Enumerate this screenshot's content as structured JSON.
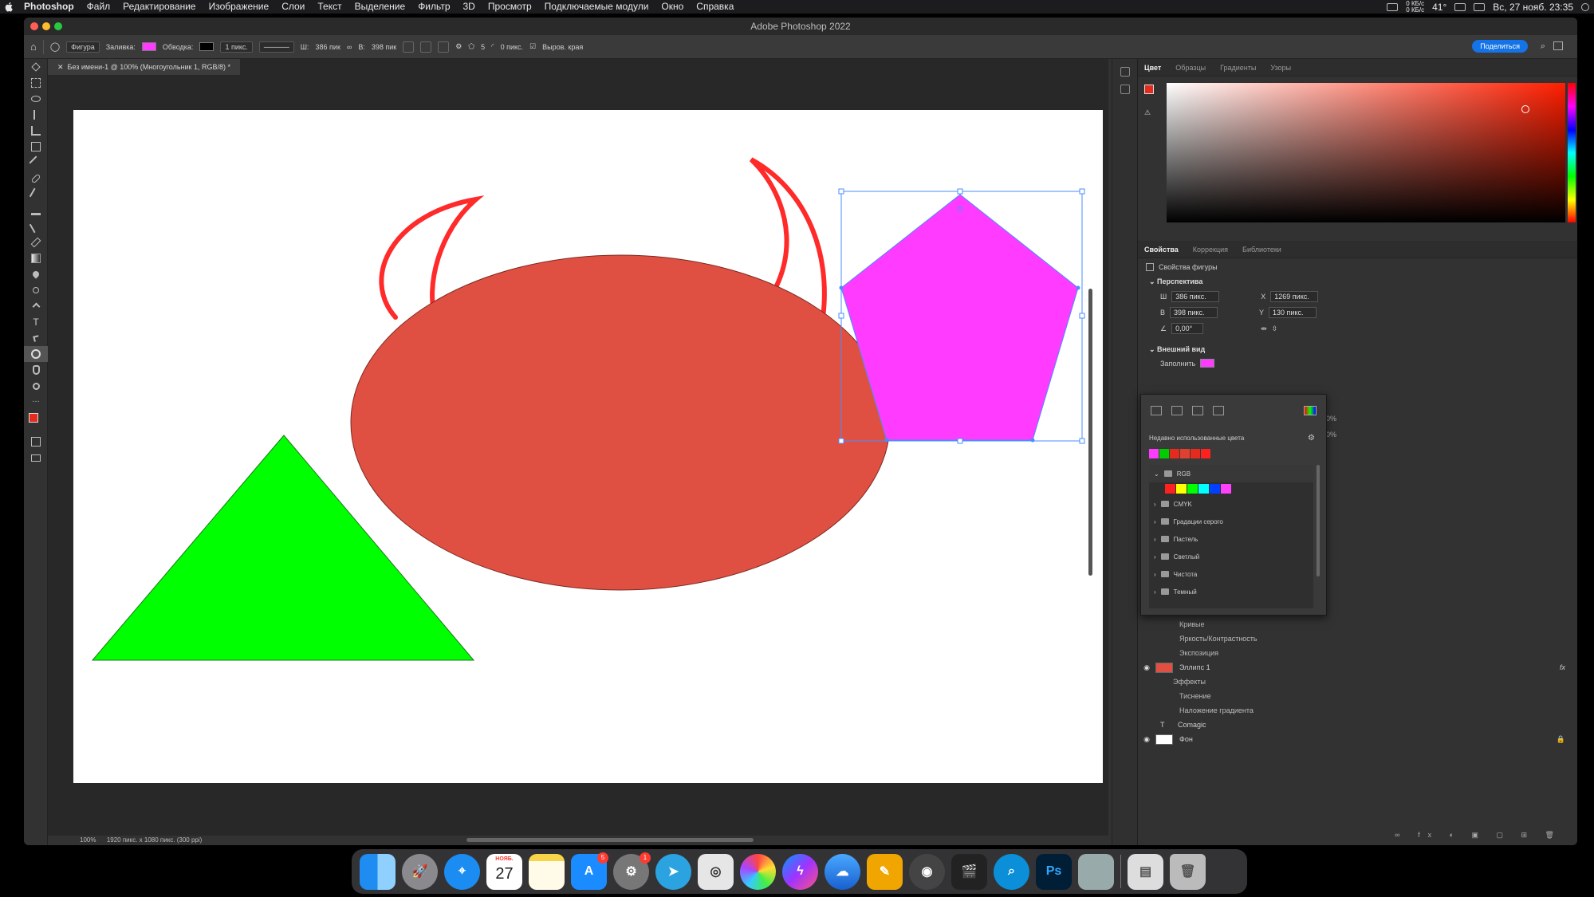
{
  "menubar": {
    "app_name": "Photoshop",
    "items": [
      "Файл",
      "Редактирование",
      "Изображение",
      "Слои",
      "Текст",
      "Выделение",
      "Фильтр",
      "3D",
      "Просмотр",
      "Подключаемые модули",
      "Окно",
      "Справка"
    ],
    "network_up": "0 КБ/с",
    "network_down": "0 КБ/с",
    "temperature": "41°",
    "datetime": "Вс, 27 нояб. 23:35"
  },
  "window": {
    "title": "Adobe Photoshop 2022"
  },
  "options_bar": {
    "mode": "Фигура",
    "fill_label": "Заливка:",
    "fill_color": "#ff3bff",
    "stroke_label": "Обводка:",
    "stroke_width": "1 пикс.",
    "w_label": "Ш:",
    "w_value": "386 пик",
    "h_label": "В:",
    "h_value": "398 пик",
    "sides": "5",
    "corner": "0 пикс.",
    "align_edges": "Выров. края",
    "share_label": "Поделиться"
  },
  "document": {
    "tab_title": "Без имени-1 @ 100% (Многоугольник 1, RGB/8) *",
    "status": "1920 пикс. x 1080 пикс. (300 ppi)",
    "zoom": "100%"
  },
  "canvas_shapes": {
    "triangle_color": "#00ff00",
    "ellipse_color": "#e05042",
    "pentagon_color": "#ff3bff",
    "horns_color": "#ff2a2a",
    "selection_color": "#4a8cff"
  },
  "color_panel": {
    "tabs": [
      "Цвет",
      "Образцы",
      "Градиенты",
      "Узоры"
    ],
    "fg_color": "#e52b1e",
    "bg_color": "#ffffff"
  },
  "properties_panel": {
    "tabs": [
      "Свойства",
      "Коррекция",
      "Библиотеки"
    ],
    "shape_props_label": "Свойства фигуры",
    "transform_title": "Перспектива",
    "w_label": "Ш",
    "w_value": "386 пикс.",
    "x_label": "X",
    "x_value": "1269 пикс.",
    "h_label": "В",
    "h_value": "398 пикс.",
    "y_label": "Y",
    "y_value": "130 пикс.",
    "angle_value": "0,00°",
    "appearance_title": "Внешний вид",
    "fill_label": "Заполнить"
  },
  "swatch_popup": {
    "recent_label": "Недавно использованные цвета",
    "recent_colors": [
      "#ff3bff",
      "#00cc00",
      "#e52b1e",
      "#e04030",
      "#e52b1e",
      "#ff2020"
    ],
    "folders": [
      {
        "name": "RGB",
        "open": true
      },
      {
        "name": "CMYK",
        "open": false
      },
      {
        "name": "Градации серого",
        "open": false
      },
      {
        "name": "Пастель",
        "open": false
      },
      {
        "name": "Светлый",
        "open": false
      },
      {
        "name": "Чистота",
        "open": false
      },
      {
        "name": "Темный",
        "open": false
      }
    ],
    "rgb_colors": [
      "#ff2020",
      "#ffff00",
      "#00ff00",
      "#00ffff",
      "#0040ff",
      "#ff40ff"
    ],
    "opacity_1": "0%",
    "opacity_2": "0%"
  },
  "layers": {
    "effects": [
      "Кривые",
      "Яркость/Контрастность",
      "Экспозиция"
    ],
    "ellipse_name": "Эллипс 1",
    "ellipse_effects_label": "Эффекты",
    "ellipse_effects": [
      "Тиснение",
      "Наложение градиента"
    ],
    "text_layer": "Comagic",
    "background_layer": "Фон"
  },
  "dock": {
    "calendar_month": "НОЯБ.",
    "calendar_day": "27",
    "appstore_badge": "5",
    "settings_badge": "1",
    "ps_label": "Ps"
  }
}
